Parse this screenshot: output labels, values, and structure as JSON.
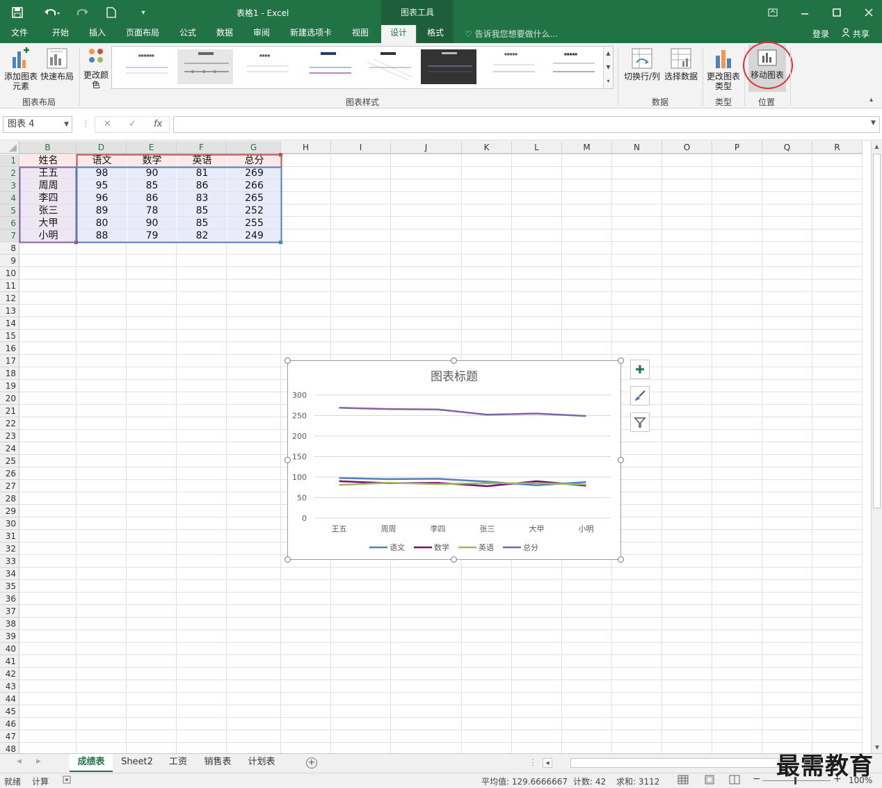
{
  "window": {
    "title": "表格1 - Excel",
    "context_tools": "图表工具",
    "qat_icons": [
      "save-icon",
      "undo-icon",
      "redo-icon",
      "new-file-icon",
      "customize-icon"
    ],
    "controls_icons": [
      "ribbon-display-icon",
      "minimize-icon",
      "maximize-icon",
      "close-icon"
    ]
  },
  "tabs": [
    {
      "label": "文件",
      "active": false
    },
    {
      "label": "开始",
      "active": false
    },
    {
      "label": "插入",
      "active": false
    },
    {
      "label": "页面布局",
      "active": false
    },
    {
      "label": "公式",
      "active": false
    },
    {
      "label": "数据",
      "active": false
    },
    {
      "label": "审阅",
      "active": false
    },
    {
      "label": "新建选项卡",
      "active": false
    },
    {
      "label": "视图",
      "active": false
    },
    {
      "label": "设计",
      "active": true
    },
    {
      "label": "格式",
      "active": false
    }
  ],
  "tell_me": "告诉我您想要做什么...",
  "login": "登录",
  "share": "共享",
  "ribbon": {
    "add_element": "添加图表元素",
    "quick_layout": "快速布局",
    "change_color": "更改颜色",
    "group_layout": "图表布局",
    "group_styles": "图表样式",
    "switch_row_col": "切换行/列",
    "select_data": "选择数据",
    "group_data": "数据",
    "change_type": "更改图表类型",
    "group_type": "类型",
    "move_chart": "移动图表",
    "group_location": "位置"
  },
  "formula": {
    "name_box": "图表 4",
    "fx": "fx",
    "value": ""
  },
  "columns": [
    "B",
    "D",
    "E",
    "F",
    "G",
    "H",
    "I",
    "J",
    "K",
    "L",
    "M",
    "N",
    "O",
    "P",
    "Q",
    "R"
  ],
  "rows": [
    "1",
    "2",
    "3",
    "4",
    "5",
    "6",
    "7",
    "8",
    "9",
    "10",
    "11",
    "12",
    "13",
    "14",
    "15",
    "16",
    "17",
    "18",
    "19",
    "20",
    "21",
    "22",
    "23",
    "24",
    "25",
    "26",
    "27",
    "28",
    "29",
    "30",
    "31",
    "32",
    "33",
    "34",
    "35",
    "36",
    "37",
    "38",
    "39",
    "40",
    "41",
    "42",
    "43",
    "44",
    "45",
    "46",
    "47",
    "48"
  ],
  "table": {
    "headers": [
      "姓名",
      "语文",
      "数学",
      "英语",
      "总分"
    ],
    "rows": [
      [
        "王五",
        "98",
        "90",
        "81",
        "269"
      ],
      [
        "周周",
        "95",
        "85",
        "86",
        "266"
      ],
      [
        "李四",
        "96",
        "86",
        "83",
        "265"
      ],
      [
        "张三",
        "89",
        "78",
        "85",
        "252"
      ],
      [
        "大甲",
        "80",
        "90",
        "85",
        "255"
      ],
      [
        "小明",
        "88",
        "79",
        "82",
        "249"
      ]
    ]
  },
  "chart_data": {
    "type": "line",
    "title": "图表标题",
    "categories": [
      "王五",
      "周周",
      "李四",
      "张三",
      "大甲",
      "小明"
    ],
    "series": [
      {
        "name": "语文",
        "values": [
          98,
          95,
          96,
          89,
          80,
          88
        ],
        "color": "#4f81bd"
      },
      {
        "name": "数学",
        "values": [
          90,
          85,
          86,
          78,
          90,
          79
        ],
        "color": "#7b0a7b"
      },
      {
        "name": "英语",
        "values": [
          81,
          86,
          83,
          85,
          85,
          82
        ],
        "color": "#9bbb59"
      },
      {
        "name": "总分",
        "values": [
          269,
          266,
          265,
          252,
          255,
          249
        ],
        "color": "#8064a2"
      }
    ],
    "ylim": [
      0,
      300
    ],
    "yticks": [
      "0",
      "50",
      "100",
      "150",
      "200",
      "250",
      "300"
    ],
    "grid": true,
    "legend": "bottom"
  },
  "sheets": [
    {
      "label": "成绩表",
      "active": true
    },
    {
      "label": "Sheet2",
      "active": false
    },
    {
      "label": "工资",
      "active": false
    },
    {
      "label": "销售表",
      "active": false
    },
    {
      "label": "计划表",
      "active": false
    }
  ],
  "status": {
    "ready": "就绪",
    "calc": "计算",
    "average": "平均值: 129.6666667",
    "count": "计数: 42",
    "sum": "求和: 3112",
    "zoom": "100%"
  },
  "watermark": "最需教育",
  "colors": {
    "brand": "#217346",
    "highlight_circle": "#e03030"
  }
}
